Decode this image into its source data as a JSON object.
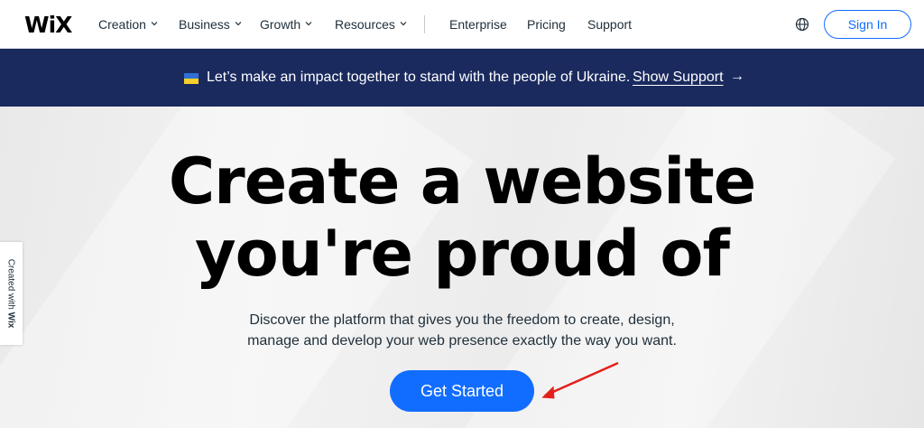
{
  "nav": {
    "logo": "WiX",
    "items": [
      {
        "label": "Creation",
        "has_dropdown": true
      },
      {
        "label": "Business",
        "has_dropdown": true
      },
      {
        "label": "Growth",
        "has_dropdown": true
      },
      {
        "label": "Resources",
        "has_dropdown": true
      },
      {
        "label": "Enterprise",
        "has_dropdown": false
      },
      {
        "label": "Pricing",
        "has_dropdown": false
      },
      {
        "label": "Support",
        "has_dropdown": false
      }
    ],
    "language_icon": "globe-icon",
    "signin_label": "Sign In"
  },
  "banner": {
    "flag_icon": "ukraine-flag-icon",
    "text": "Let’s make an impact together to stand with the people of Ukraine.",
    "link": "Show Support",
    "arrow": "→"
  },
  "hero": {
    "headline_line1": "Create a website",
    "headline_line2": "you're proud of",
    "subtitle": "Discover the platform that gives you the freedom to create, design, manage and develop your web presence exactly the way you want.",
    "cta_label": "Get Started"
  },
  "side_tab": {
    "prefix": "Created with ",
    "brand": "Wix"
  },
  "colors": {
    "accent": "#116dff",
    "banner_bg": "#1a2a5e",
    "annotation_arrow": "#e3201b"
  }
}
